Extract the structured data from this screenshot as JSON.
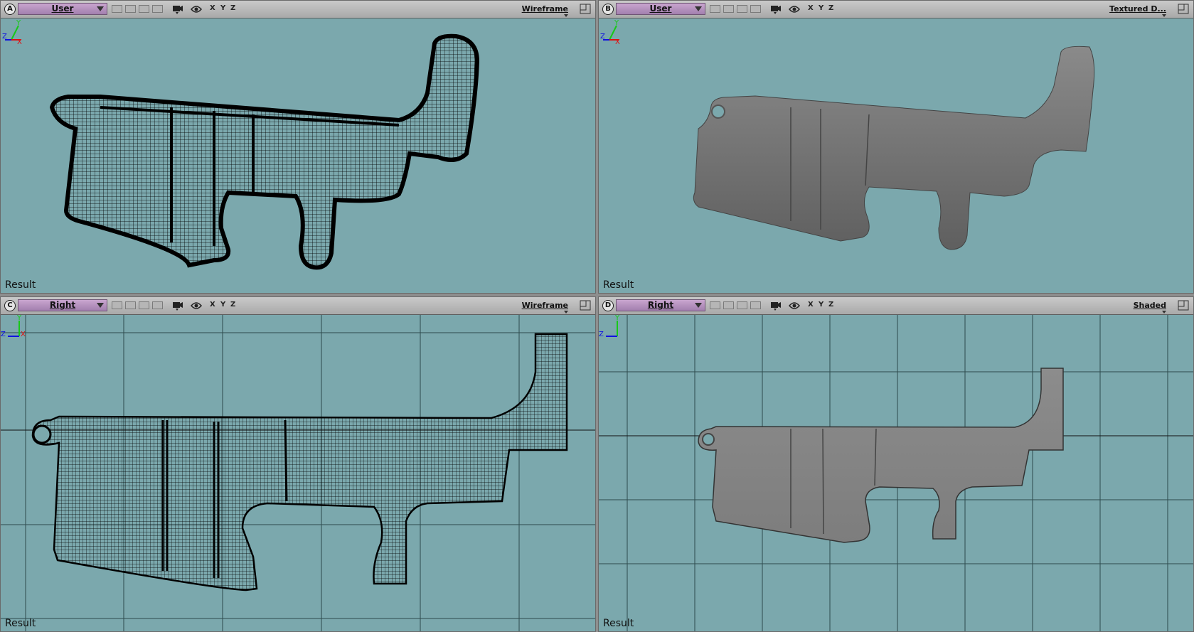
{
  "viewports": {
    "a": {
      "letter": "A",
      "camera": "User",
      "shading": "Wireframe",
      "result": "Result"
    },
    "b": {
      "letter": "B",
      "camera": "User",
      "shading": "Textured D...",
      "result": "Result"
    },
    "c": {
      "letter": "C",
      "camera": "Right",
      "shading": "Wireframe",
      "result": "Result"
    },
    "d": {
      "letter": "D",
      "camera": "Right",
      "shading": "Shaded",
      "result": "Result"
    }
  },
  "axis_buttons": {
    "x": "X",
    "y": "Y",
    "z": "Z"
  },
  "gizmo": {
    "x": "X",
    "y": "Y",
    "z": "Z"
  },
  "colors": {
    "viewport_bg": "#7ba8ad",
    "header_bg": "#b9b9b9",
    "camera_dropdown": "#b58fc0",
    "mesh_shaded": "#777777",
    "mesh_wire": "#000000",
    "grid_line": "#2e4a4d"
  },
  "icons": [
    "camera-icon",
    "eye-icon",
    "maximize-icon",
    "axis-gizmo-icon"
  ]
}
